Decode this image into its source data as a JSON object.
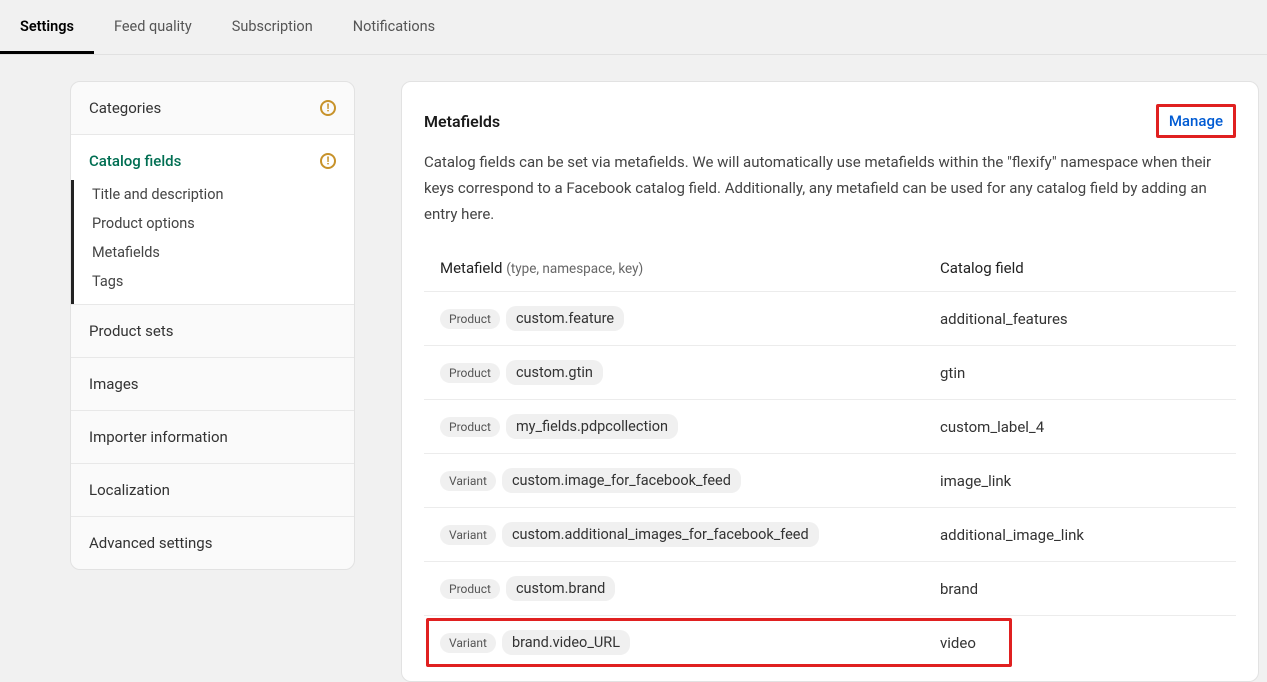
{
  "tabs": [
    {
      "label": "Settings",
      "active": true
    },
    {
      "label": "Feed quality",
      "active": false
    },
    {
      "label": "Subscription",
      "active": false
    },
    {
      "label": "Notifications",
      "active": false
    }
  ],
  "sidebar": {
    "categories": {
      "label": "Categories",
      "warn": true
    },
    "catalog_fields": {
      "label": "Catalog fields",
      "warn": true,
      "subs": [
        {
          "label": "Title and description"
        },
        {
          "label": "Product options"
        },
        {
          "label": "Metafields"
        },
        {
          "label": "Tags"
        }
      ]
    },
    "others": [
      {
        "label": "Product sets"
      },
      {
        "label": "Images"
      },
      {
        "label": "Importer information"
      },
      {
        "label": "Localization"
      },
      {
        "label": "Advanced settings"
      }
    ]
  },
  "card": {
    "title": "Metafields",
    "manage_label": "Manage",
    "desc": "Catalog fields can be set via metafields. We will automatically use metafields within the \"flexify\" namespace when their keys correspond to a Facebook catalog field. Additionally, any metafield can be used for any catalog field by adding an entry here."
  },
  "table": {
    "header_left": "Metafield",
    "header_left_hint": "(type, namespace, key)",
    "header_right": "Catalog field",
    "rows": [
      {
        "type": "Product",
        "nskey": "custom.feature",
        "catalog": "additional_features",
        "highlight": false
      },
      {
        "type": "Product",
        "nskey": "custom.gtin",
        "catalog": "gtin",
        "highlight": false
      },
      {
        "type": "Product",
        "nskey": "my_fields.pdpcollection",
        "catalog": "custom_label_4",
        "highlight": false
      },
      {
        "type": "Variant",
        "nskey": "custom.image_for_facebook_feed",
        "catalog": "image_link",
        "highlight": false
      },
      {
        "type": "Variant",
        "nskey": "custom.additional_images_for_facebook_feed",
        "catalog": "additional_image_link",
        "highlight": false
      },
      {
        "type": "Product",
        "nskey": "custom.brand",
        "catalog": "brand",
        "highlight": false
      },
      {
        "type": "Variant",
        "nskey": "brand.video_URL",
        "catalog": "video",
        "highlight": true
      }
    ]
  }
}
